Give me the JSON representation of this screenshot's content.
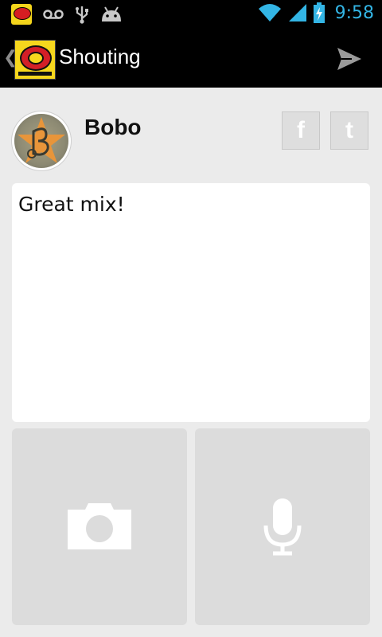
{
  "status_bar": {
    "time": "9:58",
    "icons": [
      "app-notification-icon",
      "voicemail-icon",
      "usb-icon",
      "android-debug-icon",
      "wifi-icon",
      "signal-icon",
      "battery-charging-icon"
    ]
  },
  "action_bar": {
    "title": "Shouting",
    "up_icon": "chevron-left-icon",
    "logo": "hot-radio-logo",
    "send_icon": "send-icon"
  },
  "profile": {
    "name": "Bobo"
  },
  "social": {
    "facebook_label": "f",
    "twitter_label": "t"
  },
  "message": {
    "text": "Great mix!"
  },
  "attachments": [
    {
      "icon": "camera-icon"
    },
    {
      "icon": "microphone-icon"
    }
  ],
  "colors": {
    "accent": "#33b5e5",
    "background": "#ebebeb",
    "tile": "#dcdcdc",
    "bar": "#000000"
  }
}
